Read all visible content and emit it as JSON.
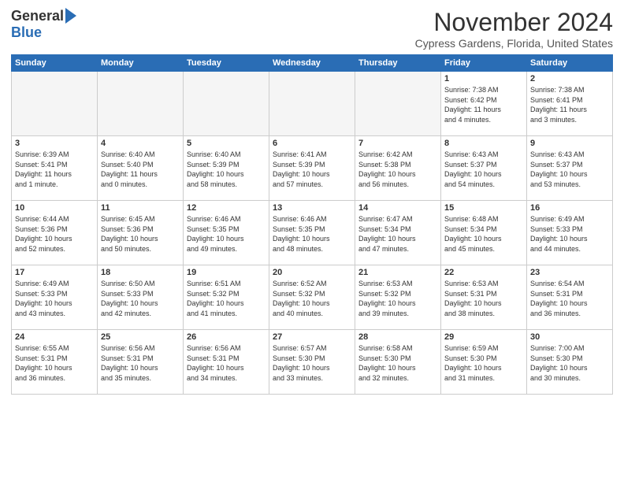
{
  "logo": {
    "general": "General",
    "blue": "Blue"
  },
  "title": "November 2024",
  "subtitle": "Cypress Gardens, Florida, United States",
  "headers": [
    "Sunday",
    "Monday",
    "Tuesday",
    "Wednesday",
    "Thursday",
    "Friday",
    "Saturday"
  ],
  "weeks": [
    [
      {
        "day": "",
        "info": "",
        "empty": true
      },
      {
        "day": "",
        "info": "",
        "empty": true
      },
      {
        "day": "",
        "info": "",
        "empty": true
      },
      {
        "day": "",
        "info": "",
        "empty": true
      },
      {
        "day": "",
        "info": "",
        "empty": true
      },
      {
        "day": "1",
        "info": "Sunrise: 7:38 AM\nSunset: 6:42 PM\nDaylight: 11 hours\nand 4 minutes."
      },
      {
        "day": "2",
        "info": "Sunrise: 7:38 AM\nSunset: 6:41 PM\nDaylight: 11 hours\nand 3 minutes."
      }
    ],
    [
      {
        "day": "3",
        "info": "Sunrise: 6:39 AM\nSunset: 5:41 PM\nDaylight: 11 hours\nand 1 minute."
      },
      {
        "day": "4",
        "info": "Sunrise: 6:40 AM\nSunset: 5:40 PM\nDaylight: 11 hours\nand 0 minutes."
      },
      {
        "day": "5",
        "info": "Sunrise: 6:40 AM\nSunset: 5:39 PM\nDaylight: 10 hours\nand 58 minutes."
      },
      {
        "day": "6",
        "info": "Sunrise: 6:41 AM\nSunset: 5:39 PM\nDaylight: 10 hours\nand 57 minutes."
      },
      {
        "day": "7",
        "info": "Sunrise: 6:42 AM\nSunset: 5:38 PM\nDaylight: 10 hours\nand 56 minutes."
      },
      {
        "day": "8",
        "info": "Sunrise: 6:43 AM\nSunset: 5:37 PM\nDaylight: 10 hours\nand 54 minutes."
      },
      {
        "day": "9",
        "info": "Sunrise: 6:43 AM\nSunset: 5:37 PM\nDaylight: 10 hours\nand 53 minutes."
      }
    ],
    [
      {
        "day": "10",
        "info": "Sunrise: 6:44 AM\nSunset: 5:36 PM\nDaylight: 10 hours\nand 52 minutes."
      },
      {
        "day": "11",
        "info": "Sunrise: 6:45 AM\nSunset: 5:36 PM\nDaylight: 10 hours\nand 50 minutes."
      },
      {
        "day": "12",
        "info": "Sunrise: 6:46 AM\nSunset: 5:35 PM\nDaylight: 10 hours\nand 49 minutes."
      },
      {
        "day": "13",
        "info": "Sunrise: 6:46 AM\nSunset: 5:35 PM\nDaylight: 10 hours\nand 48 minutes."
      },
      {
        "day": "14",
        "info": "Sunrise: 6:47 AM\nSunset: 5:34 PM\nDaylight: 10 hours\nand 47 minutes."
      },
      {
        "day": "15",
        "info": "Sunrise: 6:48 AM\nSunset: 5:34 PM\nDaylight: 10 hours\nand 45 minutes."
      },
      {
        "day": "16",
        "info": "Sunrise: 6:49 AM\nSunset: 5:33 PM\nDaylight: 10 hours\nand 44 minutes."
      }
    ],
    [
      {
        "day": "17",
        "info": "Sunrise: 6:49 AM\nSunset: 5:33 PM\nDaylight: 10 hours\nand 43 minutes."
      },
      {
        "day": "18",
        "info": "Sunrise: 6:50 AM\nSunset: 5:33 PM\nDaylight: 10 hours\nand 42 minutes."
      },
      {
        "day": "19",
        "info": "Sunrise: 6:51 AM\nSunset: 5:32 PM\nDaylight: 10 hours\nand 41 minutes."
      },
      {
        "day": "20",
        "info": "Sunrise: 6:52 AM\nSunset: 5:32 PM\nDaylight: 10 hours\nand 40 minutes."
      },
      {
        "day": "21",
        "info": "Sunrise: 6:53 AM\nSunset: 5:32 PM\nDaylight: 10 hours\nand 39 minutes."
      },
      {
        "day": "22",
        "info": "Sunrise: 6:53 AM\nSunset: 5:31 PM\nDaylight: 10 hours\nand 38 minutes."
      },
      {
        "day": "23",
        "info": "Sunrise: 6:54 AM\nSunset: 5:31 PM\nDaylight: 10 hours\nand 36 minutes."
      }
    ],
    [
      {
        "day": "24",
        "info": "Sunrise: 6:55 AM\nSunset: 5:31 PM\nDaylight: 10 hours\nand 36 minutes."
      },
      {
        "day": "25",
        "info": "Sunrise: 6:56 AM\nSunset: 5:31 PM\nDaylight: 10 hours\nand 35 minutes."
      },
      {
        "day": "26",
        "info": "Sunrise: 6:56 AM\nSunset: 5:31 PM\nDaylight: 10 hours\nand 34 minutes."
      },
      {
        "day": "27",
        "info": "Sunrise: 6:57 AM\nSunset: 5:30 PM\nDaylight: 10 hours\nand 33 minutes."
      },
      {
        "day": "28",
        "info": "Sunrise: 6:58 AM\nSunset: 5:30 PM\nDaylight: 10 hours\nand 32 minutes."
      },
      {
        "day": "29",
        "info": "Sunrise: 6:59 AM\nSunset: 5:30 PM\nDaylight: 10 hours\nand 31 minutes."
      },
      {
        "day": "30",
        "info": "Sunrise: 7:00 AM\nSunset: 5:30 PM\nDaylight: 10 hours\nand 30 minutes."
      }
    ]
  ]
}
